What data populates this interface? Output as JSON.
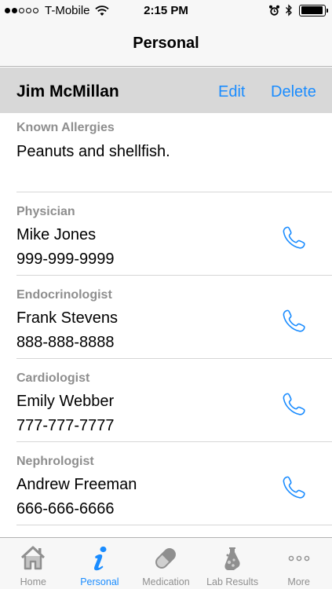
{
  "status_bar": {
    "carrier": "T-Mobile",
    "time": "2:15 PM",
    "signal_bars_filled": 2,
    "signal_bars_total": 5,
    "battery_level": 0.95
  },
  "nav": {
    "title": "Personal"
  },
  "profile": {
    "name": "Jim McMillan",
    "edit_label": "Edit",
    "delete_label": "Delete"
  },
  "allergies": {
    "label": "Known Allergies",
    "value": "Peanuts and shellfish."
  },
  "contacts": [
    {
      "role": "Physician",
      "name": "Mike Jones",
      "phone": "999-999-9999"
    },
    {
      "role": "Endocrinologist",
      "name": "Frank Stevens",
      "phone": "888-888-8888"
    },
    {
      "role": "Cardiologist",
      "name": "Emily Webber",
      "phone": "777-777-7777"
    },
    {
      "role": "Nephrologist",
      "name": "Andrew Freeman",
      "phone": "666-666-6666"
    }
  ],
  "tabs": [
    {
      "label": "Home",
      "icon": "home-icon",
      "active": false
    },
    {
      "label": "Personal",
      "icon": "info-icon",
      "active": true
    },
    {
      "label": "Medication",
      "icon": "pill-icon",
      "active": false
    },
    {
      "label": "Lab Results",
      "icon": "lab-icon",
      "active": false
    },
    {
      "label": "More",
      "icon": "more-icon",
      "active": false
    }
  ],
  "colors": {
    "accent": "#1a8cff",
    "header_bg": "#d8d8d8",
    "label_gray": "#8e8e8e",
    "tab_inactive": "#8f8f8f"
  }
}
